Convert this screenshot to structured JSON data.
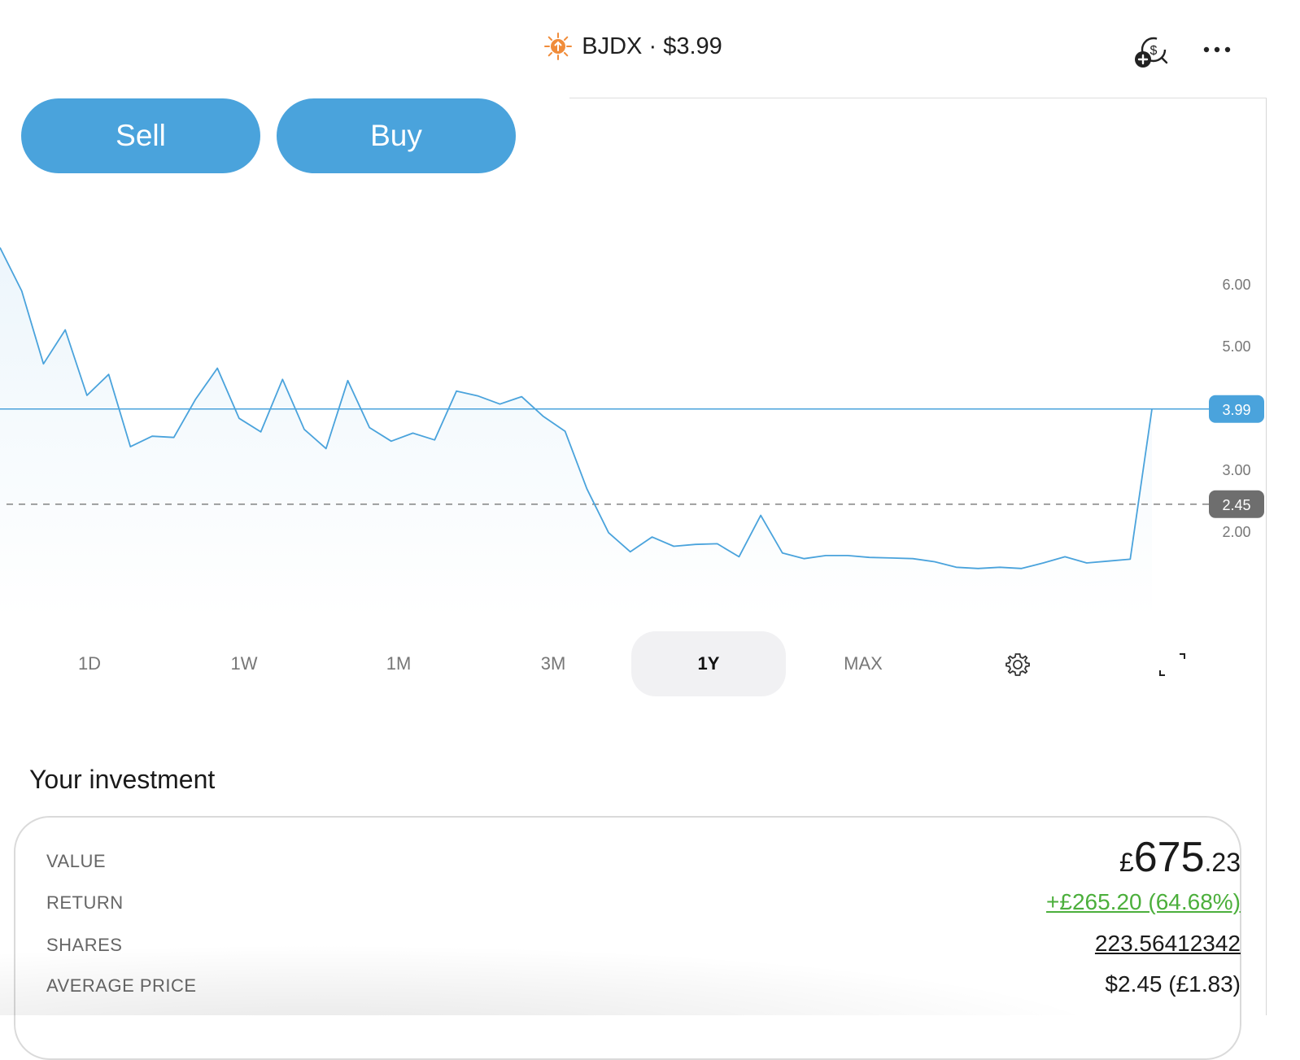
{
  "header": {
    "ticker": "BJDX",
    "separator": "·",
    "price": "$3.99",
    "icons": [
      "sun-icon",
      "add-dollar-icon",
      "more-icon"
    ]
  },
  "actions": {
    "sell_label": "Sell",
    "buy_label": "Buy"
  },
  "colors": {
    "accent": "#4aa3dc",
    "positive": "#4caf3c",
    "avg_badge": "#6e6e6e",
    "sun": "#f08c3a"
  },
  "chart_data": {
    "type": "area",
    "ylim": [
      1.0,
      7.0
    ],
    "yticks": [
      "6.00",
      "5.00",
      "3.00",
      "2.00"
    ],
    "current_price_label": "3.99",
    "current_price": 3.99,
    "average_price_label": "2.45",
    "average_price": 2.45,
    "grid": false,
    "series": [
      {
        "values": [
          6.6,
          5.9,
          4.72,
          5.27,
          4.21,
          4.55,
          3.38,
          3.55,
          3.53,
          4.15,
          4.65,
          3.84,
          3.62,
          4.47,
          3.66,
          3.35,
          4.45,
          3.69,
          3.47,
          3.6,
          3.49,
          4.28,
          4.2,
          4.07,
          4.19,
          3.87,
          3.63,
          2.7,
          1.99,
          1.68,
          1.92,
          1.77,
          1.8,
          1.81,
          1.6,
          2.27,
          1.66,
          1.57,
          1.62,
          1.62,
          1.59,
          1.58,
          1.57,
          1.52,
          1.43,
          1.41,
          1.43,
          1.41,
          1.5,
          1.6,
          1.5,
          1.53,
          1.56,
          3.99
        ]
      }
    ]
  },
  "ranges": {
    "items": [
      "1D",
      "1W",
      "1M",
      "3M",
      "1Y",
      "MAX"
    ],
    "active": "1Y"
  },
  "investment": {
    "title": "Your investment",
    "value_label": "VALUE",
    "value_currency": "£",
    "value_main": "675",
    "value_cents": ".23",
    "return_label": "RETURN",
    "return_value": "+£265.20 (64.68%)",
    "shares_label": "SHARES",
    "shares_value": "223.56412342",
    "avg_label": "AVERAGE PRICE",
    "avg_value": "$2.45 (£1.83)"
  }
}
